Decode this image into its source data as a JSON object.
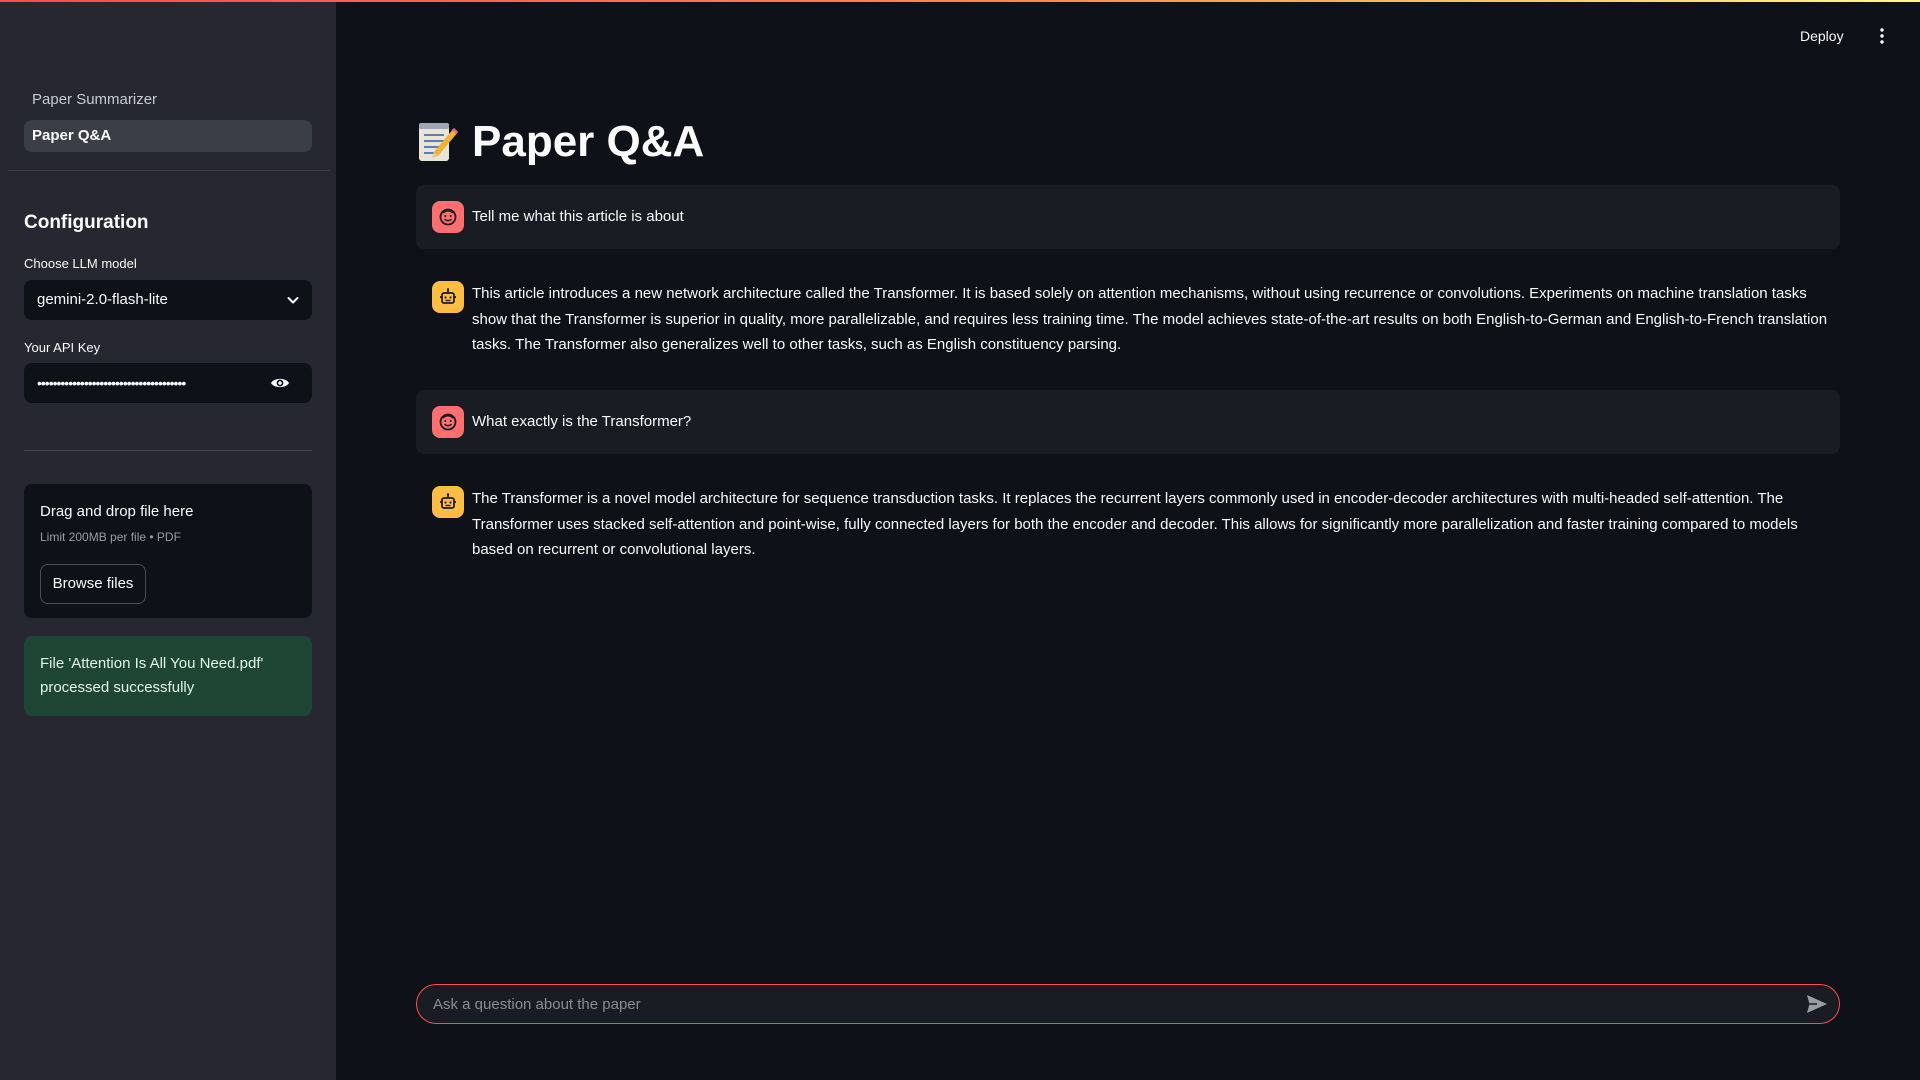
{
  "sidebar": {
    "nav": [
      {
        "label": "Paper Summarizer",
        "active": false
      },
      {
        "label": "Paper Q&A",
        "active": true
      }
    ],
    "config_title": "Configuration",
    "model_label": "Choose LLM model",
    "model_value": "gemini-2.0-flash-lite",
    "api_label": "Your API Key",
    "api_value": "••••••••••••••••••••••••••••••••••••••",
    "upload": {
      "title": "Drag and drop file here",
      "limit": "Limit 200MB per file • PDF",
      "browse_label": "Browse files"
    },
    "success_message": "File 'Attention Is All You Need.pdf' processed successfully"
  },
  "header": {
    "deploy_label": "Deploy"
  },
  "main": {
    "title": "Paper Q&A",
    "messages": [
      {
        "role": "user",
        "text": "Tell me what this article is about"
      },
      {
        "role": "assistant",
        "text": "This article introduces a new network architecture called the Transformer. It is based solely on attention mechanisms, without using recurrence or convolutions. Experiments on machine translation tasks show that the Transformer is superior in quality, more parallelizable, and requires less training time. The model achieves state-of-the-art results on both English-to-German and English-to-French translation tasks. The Transformer also generalizes well to other tasks, such as English constituency parsing."
      },
      {
        "role": "user",
        "text": "What exactly is the Transformer?"
      },
      {
        "role": "assistant",
        "text": "The Transformer is a novel model architecture for sequence transduction tasks. It replaces the recurrent layers commonly used in encoder-decoder architectures with multi-headed self-attention. The Transformer uses stacked self-attention and point-wise, fully connected layers for both the encoder and decoder. This allows for significantly more parallelization and faster training compared to models based on recurrent or convolutional layers."
      }
    ],
    "chat_placeholder": "Ask a question about the paper"
  },
  "colors": {
    "accent": "#ff4b4b",
    "user_avatar": "#ff6f6f",
    "assistant_avatar": "#ffbd45",
    "success_bg": "#1f4534"
  },
  "icons": {
    "title": "memo-icon",
    "user_avatar": "user-face-icon",
    "assistant_avatar": "robot-icon",
    "select": "chevron-down-icon",
    "password": "eye-icon",
    "menu": "kebab-menu-icon",
    "send": "send-icon"
  }
}
